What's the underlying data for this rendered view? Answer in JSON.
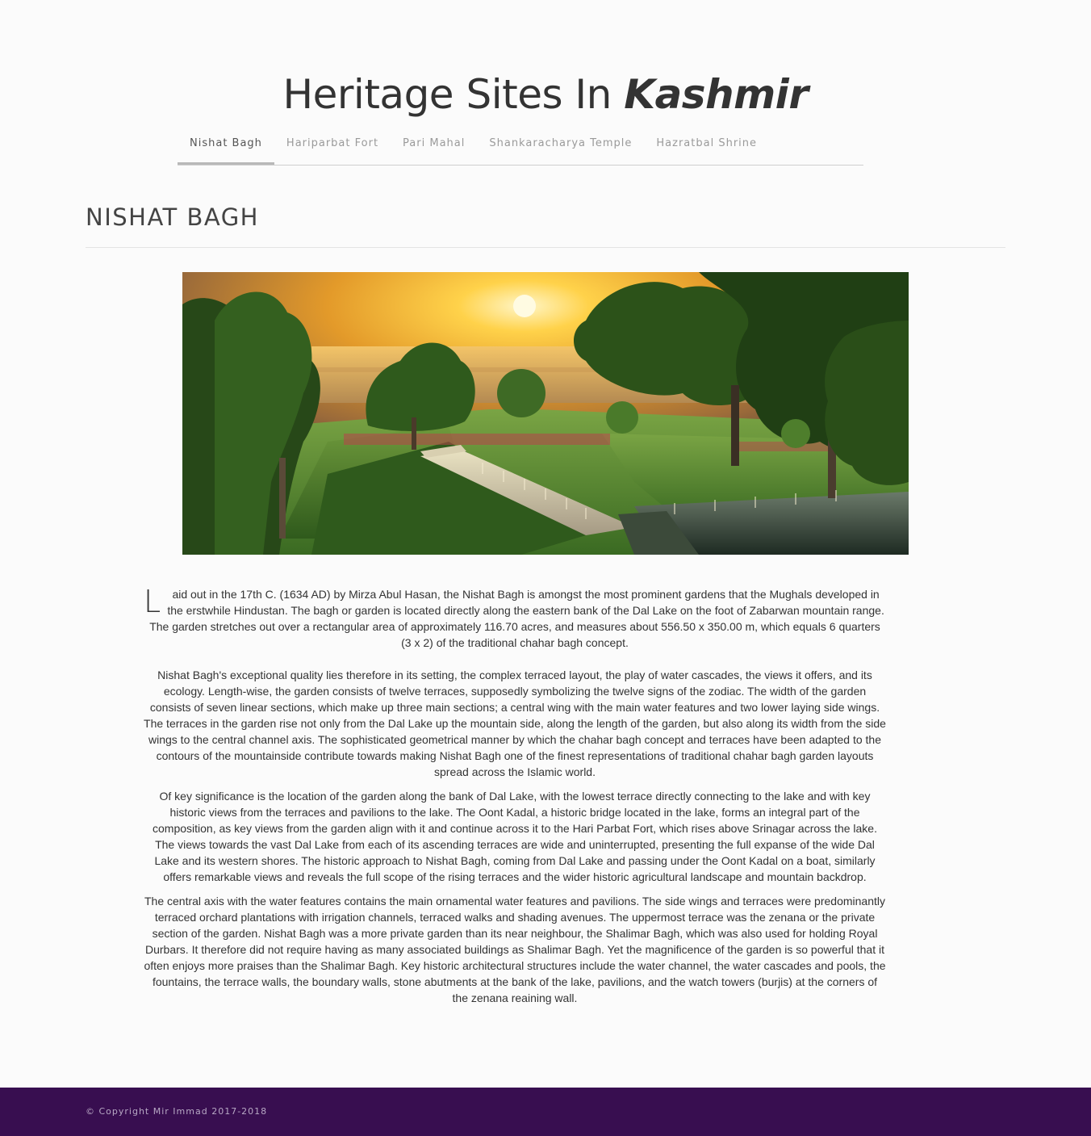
{
  "header": {
    "title_main": "Heritage Sites In ",
    "title_emphasis": "Kashmir"
  },
  "nav": {
    "items": [
      {
        "label": "Nishat Bagh",
        "active": true
      },
      {
        "label": "Hariparbat Fort",
        "active": false
      },
      {
        "label": "Pari Mahal",
        "active": false
      },
      {
        "label": "Shankaracharya Temple",
        "active": false
      },
      {
        "label": "Hazratbal Shrine",
        "active": false
      }
    ]
  },
  "main": {
    "heading": "NISHAT BAGH",
    "dropcap": "L",
    "paragraphs": [
      "aid out in the 17th C. (1634 AD) by Mirza Abul Hasan, the Nishat Bagh is amongst the most prominent gardens that the Mughals developed in the erstwhile Hindustan. The bagh or garden is located directly along the eastern bank of the Dal Lake on the foot of Zabarwan mountain range. The garden stretches out over a rectangular area of approximately 116.70 acres, and measures about 556.50 x 350.00 m, which equals 6 quarters (3 x 2) of the traditional chahar bagh concept.",
      "Nishat Bagh's exceptional quality lies therefore in its setting, the complex terraced layout, the play of water cascades, the views it offers, and its ecology. Length-wise, the garden consists of twelve terraces, supposedly symbolizing the twelve signs of the zodiac. The width of the garden consists of seven linear sections, which make up three main sections; a central wing with the main water features and two lower laying side wings. The terraces in the garden rise not only from the Dal Lake up the mountain side, along the length of the garden, but also along its width from the side wings to the central channel axis. The sophisticated geometrical manner by which the chahar bagh concept and terraces have been adapted to the contours of the mountainside contribute towards making Nishat Bagh one of the finest representations of traditional chahar bagh garden layouts spread across the Islamic world.",
      "Of key significance is the location of the garden along the bank of Dal Lake, with the lowest terrace directly connecting to the lake and with key historic views from the terraces and pavilions to the lake. The Oont Kadal, a historic bridge located in the lake, forms an integral part of the composition, as key views from the garden align with it and continue across it to the Hari Parbat Fort, which rises above Srinagar across the lake. The views towards the vast Dal Lake from each of its ascending terraces are wide and uninterrupted, presenting the full expanse of the wide Dal Lake and its western shores. The historic approach to Nishat Bagh, coming from Dal Lake and passing under the Oont Kadal on a boat, similarly offers remarkable views and reveals the full scope of the rising terraces and the wider historic agricultural landscape and mountain backdrop.",
      "The central axis with the water features contains the main ornamental water features and pavilions. The side wings and terraces were predominantly terraced orchard plantations with irrigation channels, terraced walks and shading avenues. The uppermost terrace was the zenana or the private section of the garden. Nishat Bagh was a more private garden than its near neighbour, the Shalimar Bagh, which was also used for holding Royal Durbars. It therefore did not require having as many associated buildings as Shalimar Bagh. Yet the magnificence of the garden is so powerful that it often enjoys more praises than the Shalimar Bagh. Key historic architectural structures include the water channel, the water cascades and pools, the fountains, the terrace walls, the boundary walls, stone abutments at the bank of the lake, pavilions, and the watch towers (burjis) at the corners of the zenana reaining wall."
    ]
  },
  "footer": {
    "copyright": "© Copyright Mir Immad 2017-2018"
  },
  "colors": {
    "footer_bg": "#380e50",
    "page_bg": "#fbfbfb"
  }
}
